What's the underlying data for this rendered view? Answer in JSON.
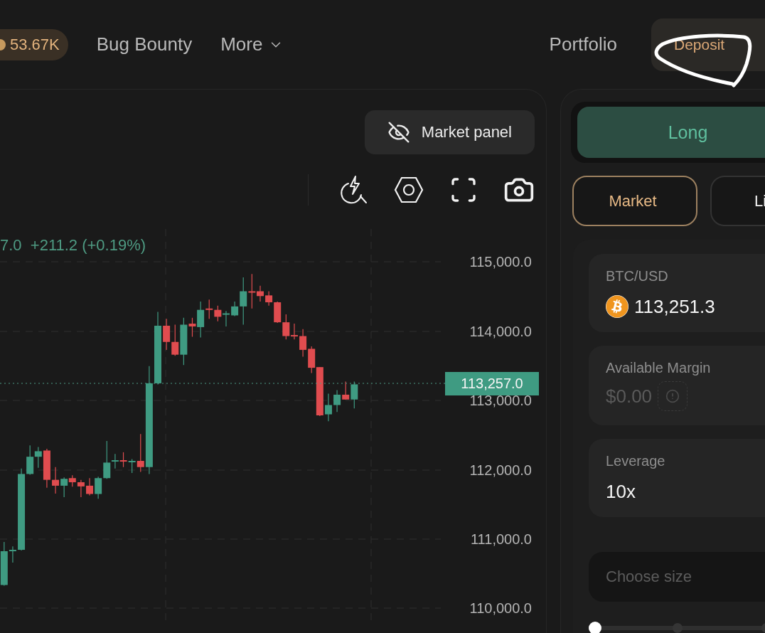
{
  "top_nav": {
    "points_badge": "53.67K",
    "links": [
      {
        "label": "Bug Bounty",
        "kind": "link"
      },
      {
        "label": "More",
        "kind": "menu"
      }
    ],
    "portfolio_link": "Portfolio",
    "deposit_button": "Deposit"
  },
  "chart_panel": {
    "market_panel_button": "Market panel",
    "change_text": "7.0  +211.2 (+0.19%)",
    "price_axis": [
      "115,000.0",
      "114,000.0",
      "113,000.0",
      "112,000.0",
      "111,000.0",
      "110,000.0"
    ],
    "last_price": "113,257.0"
  },
  "order_panel": {
    "sides": [
      {
        "label": "Long",
        "selected": true
      }
    ],
    "order_types": [
      {
        "label": "Market",
        "selected": true
      },
      {
        "label": "Li",
        "selected": false
      }
    ],
    "pair": {
      "label": "BTC/USD",
      "price": "113,251.3"
    },
    "margin": {
      "label": "Available Margin",
      "value": "$0.00",
      "disabled": true
    },
    "leverage": {
      "label": "Leverage",
      "value": "10x"
    },
    "size": {
      "placeholder": "Choose size"
    },
    "size_slider": {
      "level": 0
    }
  }
}
